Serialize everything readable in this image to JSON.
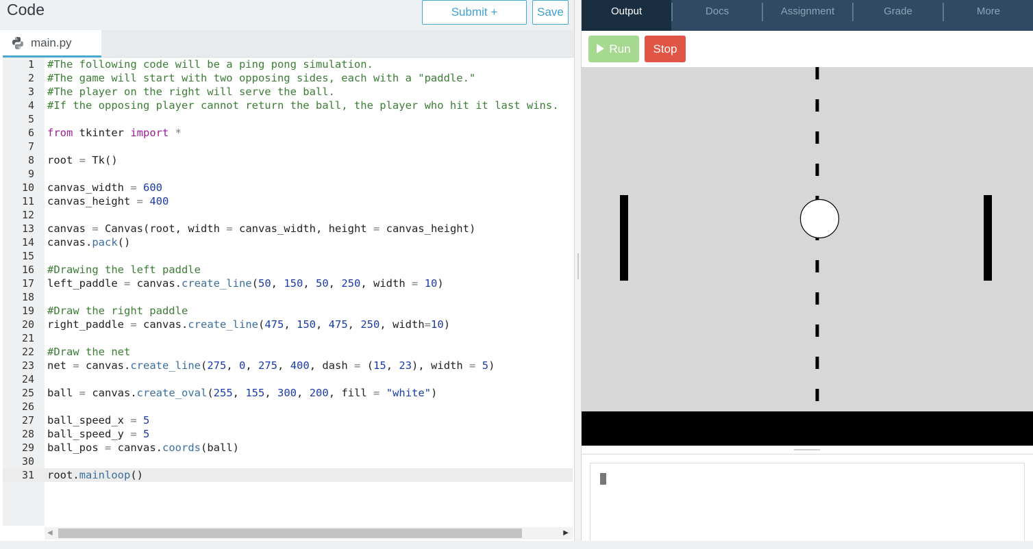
{
  "editor": {
    "title": "Code",
    "submit_label": "Submit + Continue",
    "save_label": "Save",
    "file_tab": "main.py"
  },
  "code": {
    "line_count": 31,
    "active_line": 31,
    "lines": [
      "#The following code will be a ping pong simulation.",
      "#The game will start with two opposing sides, each with a \"paddle.\"",
      "#The player on the right will serve the ball.",
      "#If the opposing player cannot return the ball, the player who hit it last wins.",
      "",
      "from tkinter import *",
      "",
      "root = Tk()",
      "",
      "canvas_width = 600",
      "canvas_height = 400",
      "",
      "canvas = Canvas(root, width = canvas_width, height = canvas_height)",
      "canvas.pack()",
      "",
      "#Drawing the left paddle",
      "left_paddle = canvas.create_line(50, 150, 50, 250, width = 10)",
      "",
      "#Draw the right paddle",
      "right_paddle = canvas.create_line(475, 150, 475, 250, width=10)",
      "",
      "#Draw the net",
      "net = canvas.create_line(275, 0, 275, 400, dash = (15, 23), width = 5)",
      "",
      "ball = canvas.create_oval(255, 155, 300, 200, fill = \"white\")",
      "",
      "ball_speed_x = 5",
      "ball_speed_y = 5",
      "ball_pos = canvas.coords(ball)",
      "",
      "root.mainloop()"
    ]
  },
  "nav": {
    "tabs": [
      "Output",
      "Docs",
      "Assignment",
      "Grade",
      "More"
    ],
    "active": "Output"
  },
  "run": {
    "run_label": "Run",
    "stop_label": "Stop"
  },
  "colors": {
    "nav_bg": "#2f4a62",
    "nav_active": "#1a2e41",
    "run_green": "#a5d98f",
    "stop_red": "#e05545",
    "accent_blue": "#45a6cf",
    "canvas_bg": "#d7d7d7"
  },
  "icons": {
    "file_tab": "python-logo-icon",
    "run": "play-icon",
    "scroll_left": "arrow-left-icon",
    "scroll_right": "arrow-right-icon"
  }
}
